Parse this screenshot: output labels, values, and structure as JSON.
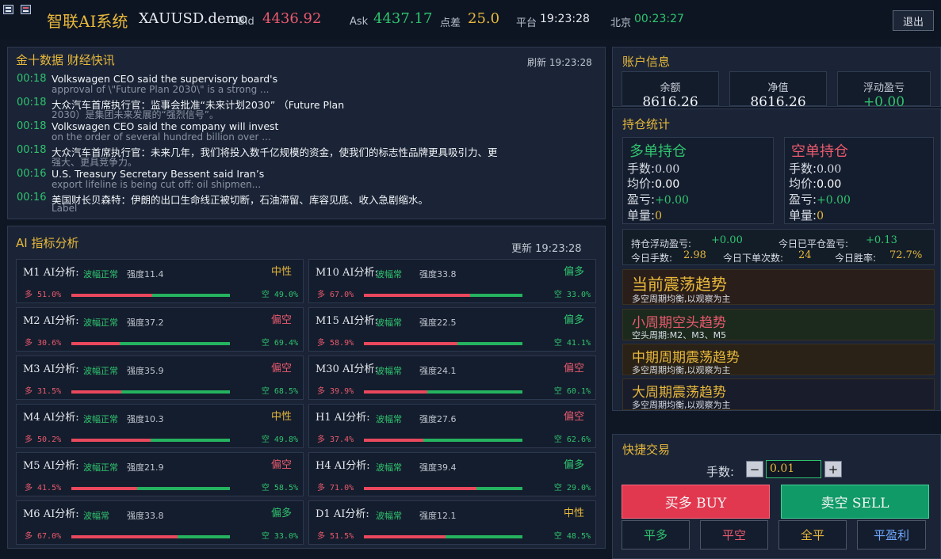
{
  "header": {
    "app_title": "智联AI系统",
    "symbol": "XAUUSD.demo",
    "bid_label": "Bid",
    "bid": "4436.92",
    "ask_label": "Ask",
    "ask": "4437.17",
    "spread_label": "点差",
    "spread": "25.0",
    "platform_label": "平台",
    "platform_time": "19:23:28",
    "beijing_label": "北京",
    "beijing_time": "00:23:27",
    "logout_label": "退出"
  },
  "news": {
    "title": "金十数据 财经快讯",
    "refresh_label": "刷新 19:23:28",
    "items": [
      {
        "time": "00:18",
        "line1": "Volkswagen CEO said the supervisory board's",
        "line2": "approval of \\\"Future Plan 2030\\\" is a strong ..."
      },
      {
        "time": "00:18",
        "line1": "大众汽车首席执行官：监事会批准“未来计划2030” （Future Plan",
        "line2": "2030）是集团未来发展的“强烈信号”。"
      },
      {
        "time": "00:18",
        "line1": "Volkswagen CEO said the company will invest",
        "line2": "on the order of several hundred billion over ..."
      },
      {
        "time": "00:18",
        "line1": "大众汽车首席执行官：未来几年，我们将投入数千亿规模的资金，使我们的标志性品牌更具吸引力、更",
        "line2": "强大、更具竞争力。"
      },
      {
        "time": "00:16",
        "line1": "U.S. Treasury Secretary Bessent said Iran’s",
        "line2": "export lifeline is being cut off: oil shipmen..."
      },
      {
        "time": "00:16",
        "line1": "美国财长贝森特：伊朗的出口生命线正被切断，石油滞留、库容见底、收入急剧缩水。",
        "line2": "Label"
      }
    ]
  },
  "ai": {
    "title": "AI 指标分析",
    "update_label": "更新 19:23:28",
    "cards": [
      {
        "name": "M1 AI分析:",
        "wave": "波幅正常",
        "strength": "强度11.4",
        "dir": "中性",
        "dir_color": "#e8b83c",
        "long": "多 51.0%",
        "short": "空 49.0%",
        "long_frac": 0.51
      },
      {
        "name": "M10 AI分析:",
        "wave": "波幅常",
        "strength": "强度33.8",
        "dir": "偏多",
        "dir_color": "#2fc46f",
        "long": "多 67.0%",
        "short": "空 33.0%",
        "long_frac": 0.67
      },
      {
        "name": "M2 AI分析:",
        "wave": "波幅正常",
        "strength": "强度37.2",
        "dir": "偏空",
        "dir_color": "#ea5a6e",
        "long": "多 30.6%",
        "short": "空 69.4%",
        "long_frac": 0.306
      },
      {
        "name": "M15 AI分析:",
        "wave": "波幅常",
        "strength": "强度22.5",
        "dir": "偏多",
        "dir_color": "#2fc46f",
        "long": "多 58.9%",
        "short": "空 41.1%",
        "long_frac": 0.589
      },
      {
        "name": "M3 AI分析:",
        "wave": "波幅正常",
        "strength": "强度35.9",
        "dir": "偏空",
        "dir_color": "#ea5a6e",
        "long": "多 31.5%",
        "short": "空 68.5%",
        "long_frac": 0.315
      },
      {
        "name": "M30 AI分析:",
        "wave": "波幅常",
        "strength": "强度24.1",
        "dir": "偏空",
        "dir_color": "#ea5a6e",
        "long": "多 39.9%",
        "short": "空 60.1%",
        "long_frac": 0.399
      },
      {
        "name": "M4 AI分析:",
        "wave": "波幅正常",
        "strength": "强度10.3",
        "dir": "中性",
        "dir_color": "#e8b83c",
        "long": "多 50.2%",
        "short": "空 49.8%",
        "long_frac": 0.502
      },
      {
        "name": "H1 AI分析:",
        "wave": "波幅常",
        "strength": "强度27.6",
        "dir": "偏空",
        "dir_color": "#ea5a6e",
        "long": "多 37.4%",
        "short": "空 62.6%",
        "long_frac": 0.374
      },
      {
        "name": "M5 AI分析:",
        "wave": "波幅正常",
        "strength": "强度21.9",
        "dir": "偏空",
        "dir_color": "#ea5a6e",
        "long": "多 41.5%",
        "short": "空 58.5%",
        "long_frac": 0.415
      },
      {
        "name": "H4 AI分析:",
        "wave": "波幅常",
        "strength": "强度39.4",
        "dir": "偏多",
        "dir_color": "#2fc46f",
        "long": "多 71.0%",
        "short": "空 29.0%",
        "long_frac": 0.71
      },
      {
        "name": "M6 AI分析:",
        "wave": "波幅常",
        "strength": "强度33.8",
        "dir": "偏多",
        "dir_color": "#2fc46f",
        "long": "多 67.0%",
        "short": "空 33.0%",
        "long_frac": 0.67
      },
      {
        "name": "D1 AI分析:",
        "wave": "波幅常",
        "strength": "强度12.1",
        "dir": "中性",
        "dir_color": "#e8b83c",
        "long": "多 51.5%",
        "short": "空 48.5%",
        "long_frac": 0.515
      }
    ]
  },
  "account": {
    "title": "账户信息",
    "balance_label": "余额",
    "balance": "8616.26",
    "equity_label": "净值",
    "equity": "8616.26",
    "float_label": "浮动盈亏",
    "float": "+0.00"
  },
  "positions": {
    "title": "持仓统计",
    "long": {
      "title": "多单持仓",
      "lots_label": "手数:",
      "lots": "0.00",
      "avg_label": "均价:",
      "avg": "0.00",
      "pnl_label": "盈亏:",
      "pnl": "+0.00",
      "count_label": "单量:",
      "count": "0"
    },
    "short": {
      "title": "空单持仓",
      "lots_label": "手数:",
      "lots": "0.00",
      "avg_label": "均价:",
      "avg": "0.00",
      "pnl_label": "盈亏:",
      "pnl": "+0.00",
      "count_label": "单量:",
      "count": "0"
    }
  },
  "stats": {
    "float_pnl_label": "持仓浮动盈亏:",
    "float_pnl": "+0.00",
    "closed_pnl_label": "今日已平仓盈亏:",
    "closed_pnl": "+0.13",
    "today_lots_label": "今日手数:",
    "today_lots": "2.98",
    "today_orders_label": "今日下单次数:",
    "today_orders": "24",
    "winrate_label": "今日胜率:",
    "winrate": "72.7%"
  },
  "trends": [
    {
      "title": "当前震荡趋势",
      "sub": "多空周期均衡,以观察为主",
      "color": "#e8b83c",
      "bg": "#2a1e1a"
    },
    {
      "title": "小周期空头趋势",
      "sub": "空头周期:M2、M3、M5",
      "color": "#ea5a6e",
      "bg": "#1c2a1e"
    },
    {
      "title": "中期周期震荡趋势",
      "sub": "多空周期均衡,以观察为主",
      "color": "#e8b83c",
      "bg": "#2a2216"
    },
    {
      "title": "大周期震荡趋势",
      "sub": "多空周期均衡,以观察为主",
      "color": "#e8b83c",
      "bg": "#191c2a"
    }
  ],
  "trade": {
    "title": "快捷交易",
    "lots_label": "手数:",
    "lots_value": "0.01",
    "minus": "−",
    "plus": "+",
    "buy_label": "买多 BUY",
    "sell_label": "卖空 SELL",
    "close_long": "平多",
    "close_short": "平空",
    "close_all": "全平",
    "close_profit": "平盈利"
  },
  "colors": {
    "accent": "#e8b83c",
    "up": "#2fc46f",
    "down": "#ea5a6e",
    "buy_bg": "#e2384f",
    "sell_bg": "#0f9a67"
  }
}
